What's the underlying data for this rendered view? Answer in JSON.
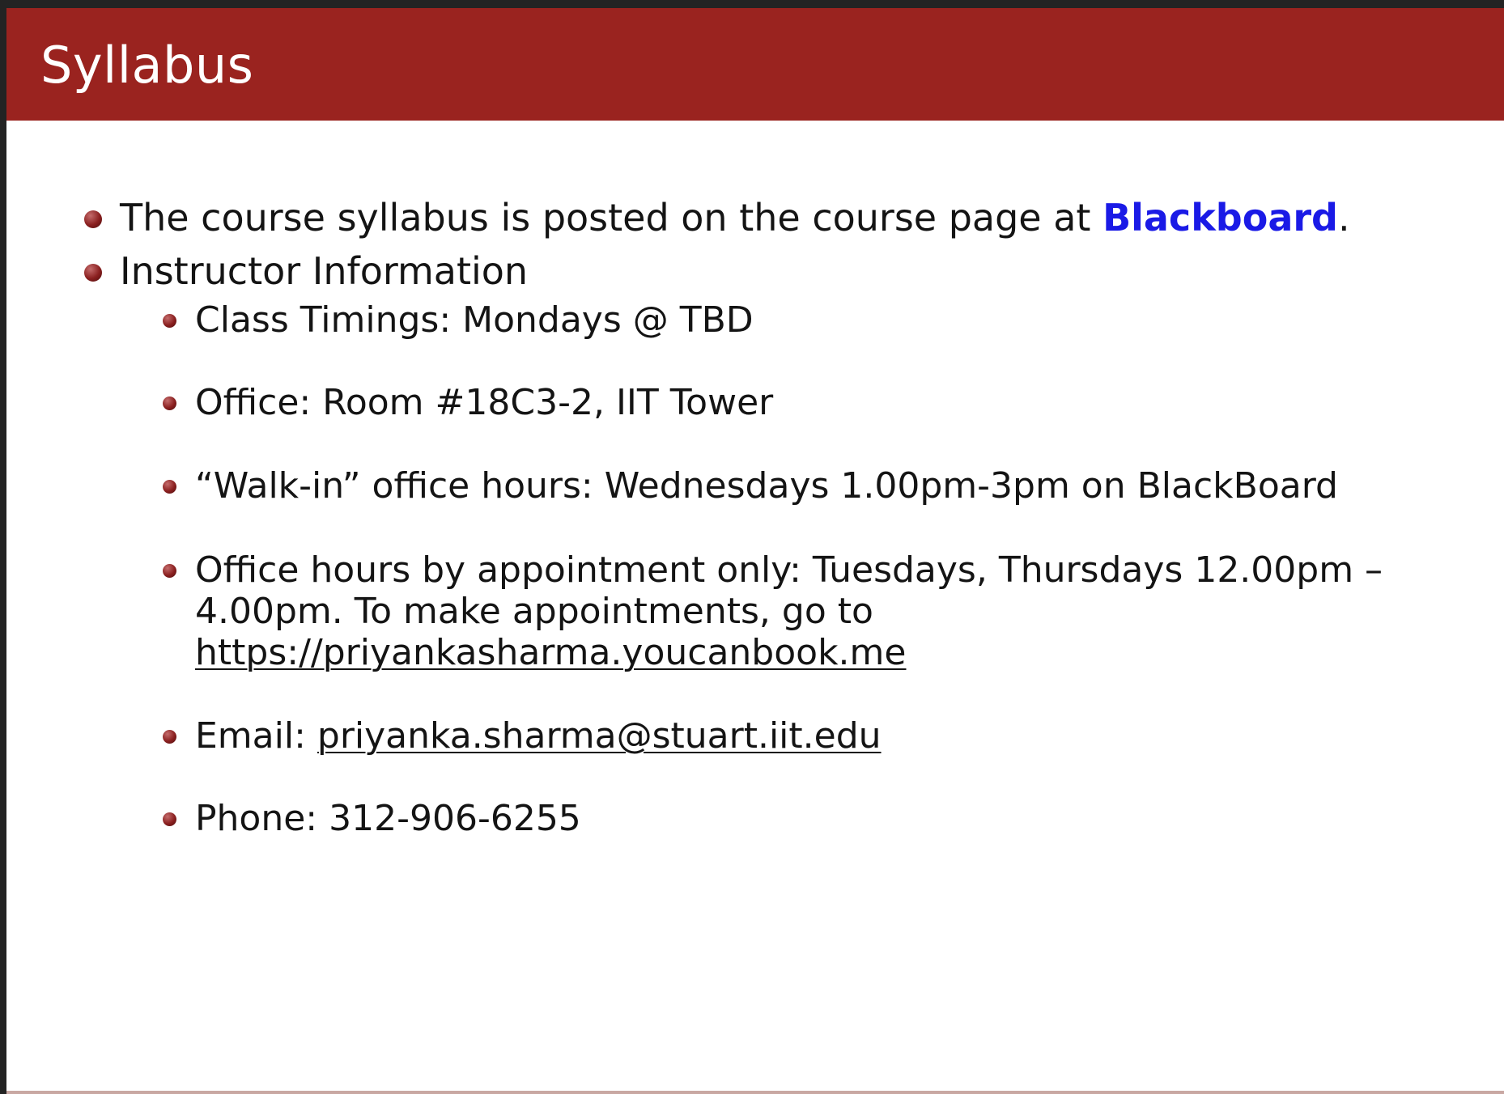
{
  "slide": {
    "title": "Syllabus",
    "items": [
      {
        "prefix": "The course syllabus is posted on the course page at ",
        "link": "Blackboard",
        "suffix": "."
      },
      {
        "text": "Instructor Information"
      }
    ],
    "sub_items": [
      {
        "text": "Class Timings: Mondays @ TBD"
      },
      {
        "text": "Office: Room #18C3-2, IIT Tower"
      },
      {
        "text": "“Walk-in” office hours: Wednesdays 1.00pm-3pm on BlackBoard"
      },
      {
        "line1": "Office hours by appointment only: Tuesdays, Thursdays 12.00pm –",
        "line2": "4.00pm. To make appointments, go to",
        "link": "https://priyankasharma.youcanbook.me"
      },
      {
        "label": "Email: ",
        "link": "priyanka.sharma@stuart.iit.edu"
      },
      {
        "text": "Phone: 312-906-6255"
      }
    ]
  },
  "colors": {
    "title_bar": "#9a231f",
    "link": "#1a1ae6",
    "outer_frame": "#232323"
  }
}
